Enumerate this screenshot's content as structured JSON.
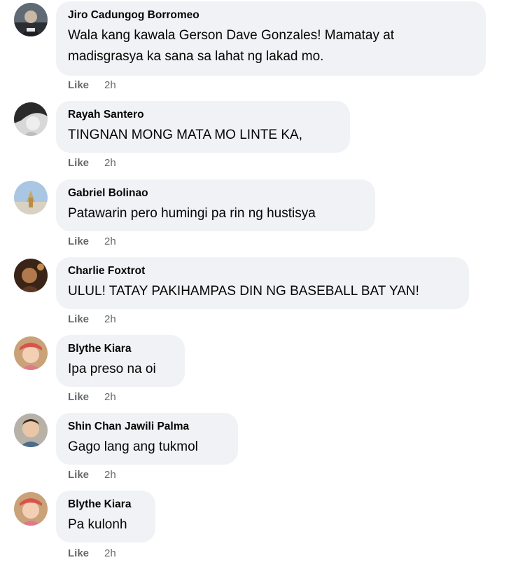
{
  "comments": [
    {
      "author": "Jiro Cadungog Borromeo",
      "text_lines": [
        "Wala kang kawala Gerson Dave Gonzales! Mamatay at",
        "madisgrasya ka sana sa lahat ng lakad mo."
      ],
      "like_label": "Like",
      "time": "2h"
    },
    {
      "author": "Rayah Santero",
      "text_lines": [
        "TINGNAN MONG MATA MO LINTE KA,"
      ],
      "like_label": "Like",
      "time": "2h"
    },
    {
      "author": "Gabriel Bolinao",
      "text_lines": [
        "Patawarin pero humingi pa rin ng hustisya"
      ],
      "like_label": "Like",
      "time": "2h"
    },
    {
      "author": "Charlie Foxtrot",
      "text_lines": [
        "ULUL! TATAY PAKIHAMPAS DIN NG BASEBALL BAT YAN!"
      ],
      "like_label": "Like",
      "time": "2h"
    },
    {
      "author": "Blythe Kiara",
      "text_lines": [
        "Ipa preso na oi"
      ],
      "like_label": "Like",
      "time": "2h"
    },
    {
      "author": "Shin Chan Jawili Palma",
      "text_lines": [
        "Gago lang ang tukmol"
      ],
      "like_label": "Like",
      "time": "2h"
    },
    {
      "author": "Blythe Kiara",
      "text_lines": [
        "Pa kulonh"
      ],
      "like_label": "Like",
      "time": "2h"
    }
  ],
  "colors": {
    "bubble": "#f0f2f5",
    "text": "#050505",
    "meta": "#65676b"
  }
}
